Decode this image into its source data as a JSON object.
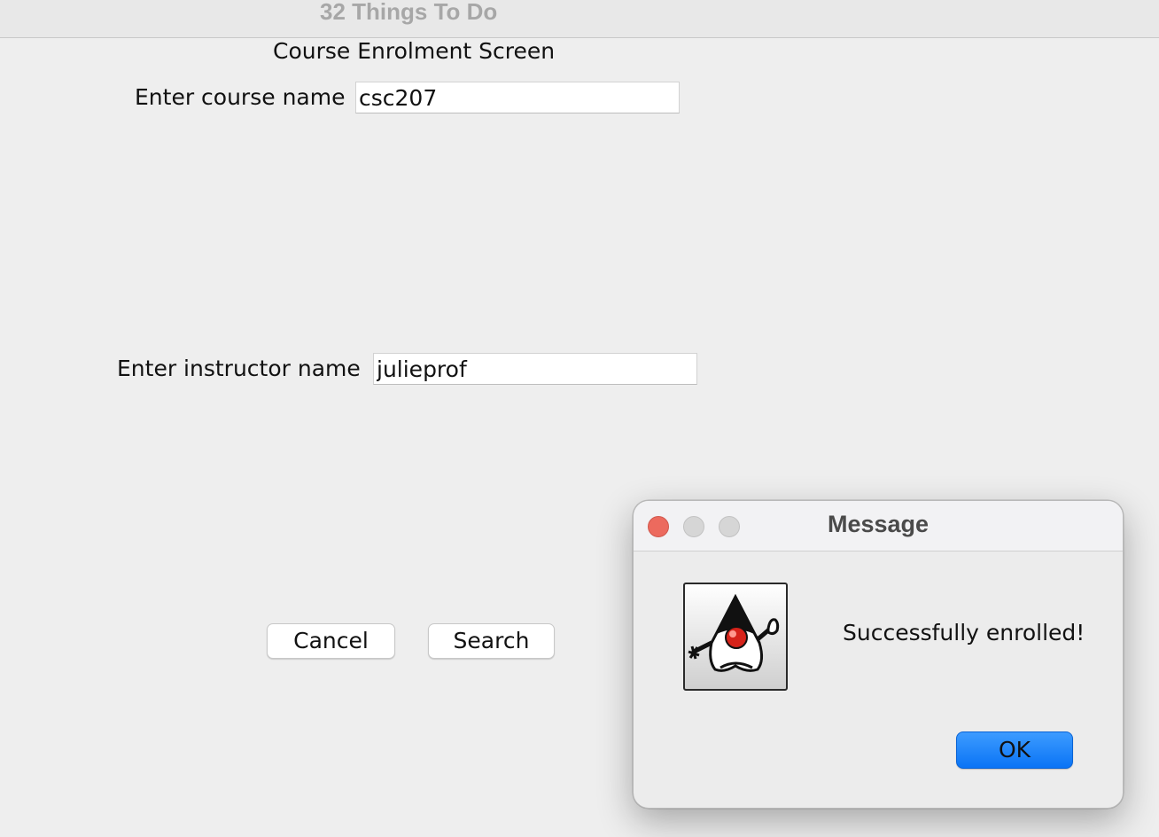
{
  "window": {
    "title": "32 Things To Do"
  },
  "form": {
    "heading": "Course Enrolment Screen",
    "course_label": "Enter course name",
    "course_value": "csc207",
    "instructor_label": "Enter instructor name",
    "instructor_value": "julieprof",
    "cancel_label": "Cancel",
    "search_label": "Search"
  },
  "dialog": {
    "title": "Message",
    "icon": "java-duke-icon",
    "message": "Successfully enrolled!",
    "ok_label": "OK",
    "accent_color": "#0a74f5"
  }
}
